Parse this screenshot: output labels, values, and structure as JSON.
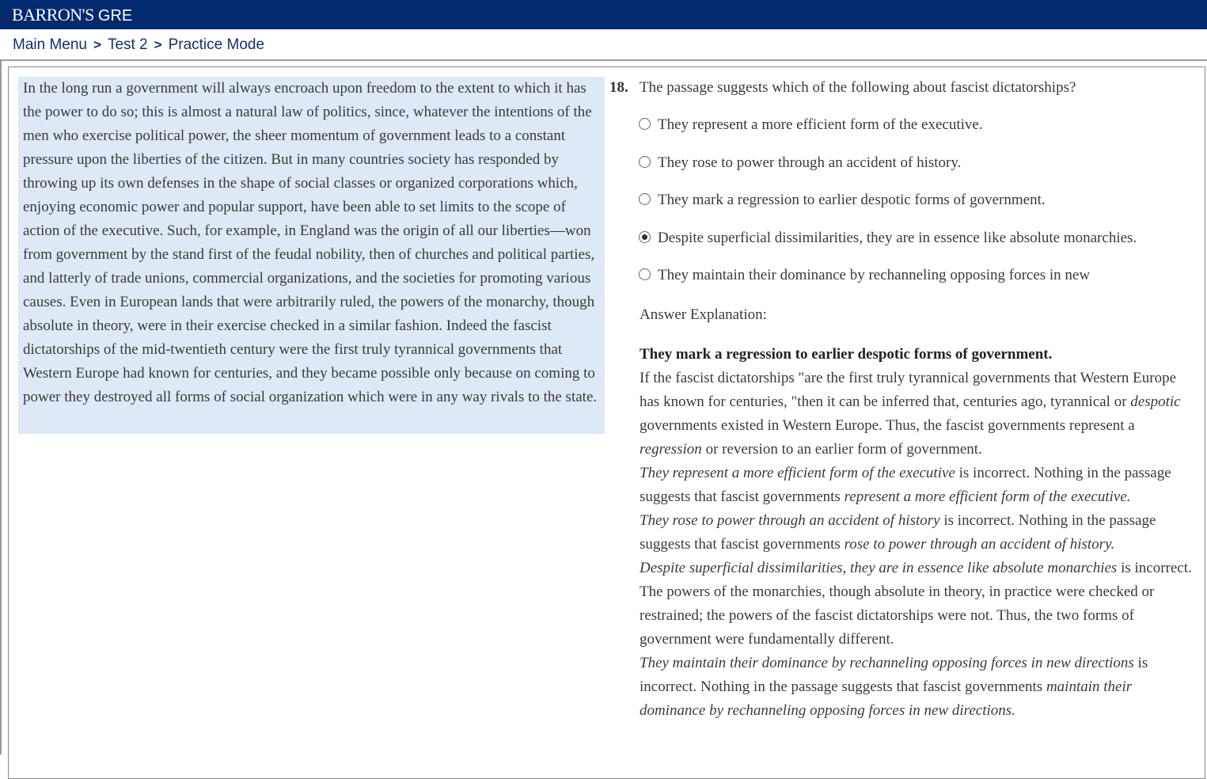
{
  "header": {
    "brand_name": "BARRON'S",
    "product": "GRE",
    "accent_color": "#03296f"
  },
  "breadcrumb": {
    "items": [
      "Main Menu",
      "Test 2",
      "Practice Mode"
    ],
    "separator": ">"
  },
  "passage": {
    "background_color": "#dde9f7",
    "text": "In the long run a government will always encroach upon freedom to the extent to which it has the power to do so; this is almost a natural law of politics, since, whatever the intentions of the men who exercise political power, the sheer momentum of government leads to a constant pressure upon the liberties of the citizen. But in many countries society has responded by throwing up its own defenses in the shape of social classes or organized corporations which, enjoying economic power and popular support, have been able to set limits to the scope of action of the executive. Such, for example, in England was the origin of all our liberties—won from government by the stand first of the feudal nobility, then of churches and political parties, and latterly of trade unions, commercial organizations, and the societies for promoting various causes. Even in European lands that were arbitrarily ruled, the powers of the monarchy, though absolute in theory, were in their exercise checked in a similar fashion. Indeed the fascist dictatorships of the mid-twentieth century were the first truly tyrannical governments that Western Europe had known for centuries, and they became possible only because on coming to power they destroyed all forms of social organization which were in any way rivals to the state."
  },
  "question": {
    "number": "18.",
    "stem": "The passage suggests which of the following about fascist dictatorships?",
    "choices": [
      {
        "text": "They represent a more efficient form of the executive.",
        "selected": false
      },
      {
        "text": "They rose to power through an accident of history.",
        "selected": false
      },
      {
        "text": "They mark a regression to earlier despotic forms of government.",
        "selected": false
      },
      {
        "text": "Despite superficial dissimilarities, they are in essence like absolute monarchies.",
        "selected": true
      },
      {
        "text": "They maintain their dominance by rechanneling opposing forces in new",
        "selected": false
      }
    ]
  },
  "explanation": {
    "heading": "Answer Explanation:",
    "correct_answer": "They mark a regression to earlier despotic forms of government.",
    "p1": {
      "a": "If the fascist dictatorships \"are the first truly tyrannical governments that Western Europe has known for centuries, \"then it can be inferred that, centuries ago, tyrannical or ",
      "b": "despotic",
      "c": " governments existed in Western Europe. Thus, the fascist governments represent a ",
      "d": "regression",
      "e": " or reversion to an earlier form of government."
    },
    "p2": {
      "a": "They represent a more efficient form of the executive",
      "b": " is incorrect. Nothing in the passage suggests that fascist governments ",
      "c": "represent a more efficient form of the executive."
    },
    "p3": {
      "a": "They rose to power through an accident of history",
      "b": " is incorrect. Nothing in the passage suggests that fascist governments ",
      "c": "rose to power through an accident of history."
    },
    "p4": {
      "a": " Despite superficial dissimilarities, they are in essence like absolute monarchies",
      "b": " is incorrect. The powers of the monarchies, though absolute in theory, in practice were checked or restrained; the powers of the fascist dictatorships were not. Thus, the two forms of government were fundamentally different."
    },
    "p5": {
      "a": " They maintain their dominance by rechanneling opposing forces in new directions",
      "b": " is incorrect. Nothing in the passage suggests that fascist governments ",
      "c": "maintain their dominance by rechanneling opposing forces in new directions."
    }
  }
}
